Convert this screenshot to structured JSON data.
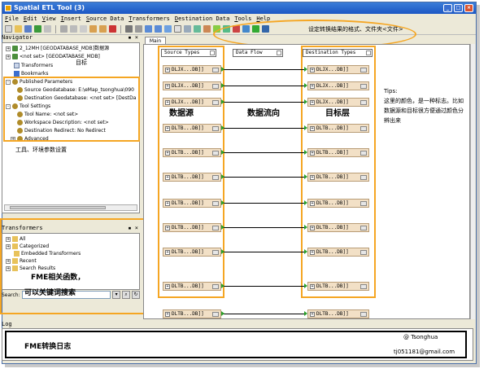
{
  "window": {
    "title": "Spatial ETL Tool (3)"
  },
  "menu": [
    "File",
    "Edit",
    "View",
    "Insert",
    "Source Data",
    "Transformers",
    "Destination Data",
    "Tools",
    "Help"
  ],
  "toolbar": {
    "note": "设定转换结果的格式、文件夹<文件>"
  },
  "navigator": {
    "title": "Navigator",
    "items": [
      {
        "label": "2_12MH [GEODATABASE_MDB]数据源",
        "icon": "database-icon",
        "expander": "+"
      },
      {
        "label": "<not set> [GEODATABASE_MDB]",
        "icon": "database-icon",
        "expander": "+"
      },
      {
        "label": "Transformers",
        "icon": "document-icon",
        "expander": ""
      },
      {
        "label": "Bookmarks",
        "icon": "bookmark-icon",
        "expander": ""
      },
      {
        "label": "Published Parameters",
        "icon": "gear-icon",
        "expander": "-"
      },
      {
        "label": "Source Geodatabase: E:\\eMap_tsonghua\\090",
        "icon": "gear-icon",
        "expander": ""
      },
      {
        "label": "Destination Geodatabase: <not set> [DestDa",
        "icon": "gear-icon",
        "expander": ""
      },
      {
        "label": "Tool Settings",
        "icon": "gear-icon",
        "expander": "-"
      },
      {
        "label": "Tool Name: <not set>",
        "icon": "gear-icon",
        "expander": ""
      },
      {
        "label": "Workspace Description: <not set>",
        "icon": "gear-icon",
        "expander": ""
      },
      {
        "label": "Destination Redirect: No Redirect",
        "icon": "gear-icon",
        "expander": ""
      },
      {
        "label": "Advanced",
        "icon": "gear-icon",
        "expander": "+"
      }
    ],
    "target_note": "目标",
    "caption": "工具、环境参数设置"
  },
  "transformers": {
    "title": "Transformers",
    "items": [
      {
        "label": "All",
        "expander": "+"
      },
      {
        "label": "Categorized",
        "expander": "+"
      },
      {
        "label": "Embedded Transformers",
        "expander": ""
      },
      {
        "label": "Recent",
        "expander": "+"
      },
      {
        "label": "Search Results",
        "expander": "+"
      }
    ],
    "caption_line1": "FME相关函数，",
    "caption_line2": "可以关键词搜索",
    "search_label": "Search:"
  },
  "canvas": {
    "tab": "Main",
    "source_header": "Source Types",
    "flow_header": "Data Flow",
    "dest_header": "Destination Types",
    "source_caption": "数据源",
    "flow_caption": "数据流向",
    "dest_caption": "目标层",
    "rows": [
      {
        "source": "DLJX...DB]]",
        "dest": "DLJX...DB]]"
      },
      {
        "source": "DLJX...DB]]",
        "dest": "DLJX...DB]]"
      },
      {
        "source": "DLJX...DB]]",
        "dest": "DLJX...DB]]"
      },
      {
        "source": "DLTB...DB]]",
        "dest": "DLTB...DB]]"
      },
      {
        "source": "DLTB...DB]]",
        "dest": "DLTB...DB]]"
      },
      {
        "source": "DLTB...DB]]",
        "dest": "DLTB...DB]]"
      },
      {
        "source": "DLTB...DB]]",
        "dest": "DLTB...DB]]"
      },
      {
        "source": "DLTB...DB]]",
        "dest": "DLTB...DB]]"
      },
      {
        "source": "DLTB...DB]]",
        "dest": "DLTB...DB]]"
      },
      {
        "source": "DLTB...DB]]",
        "dest": "DLTB...DB]]"
      },
      {
        "source": "DLTB...DB]]",
        "dest": "DLTB...DB]]"
      }
    ]
  },
  "tips": {
    "title": "Tips:",
    "lines": [
      "这里的颜色，是一种标志。比如",
      "数据源和目标很方便通过颜色分",
      "辨出来"
    ]
  },
  "log": {
    "title": "Log",
    "caption": "FME转换日志",
    "credit1": "@ Tsonghua",
    "credit2": "tj051181@gmail.com"
  },
  "colors": {
    "accent": "#f5a623",
    "feature_bg": "#f2e0c6",
    "port": "#2aa02a",
    "title_blue": "#1c57c4"
  }
}
